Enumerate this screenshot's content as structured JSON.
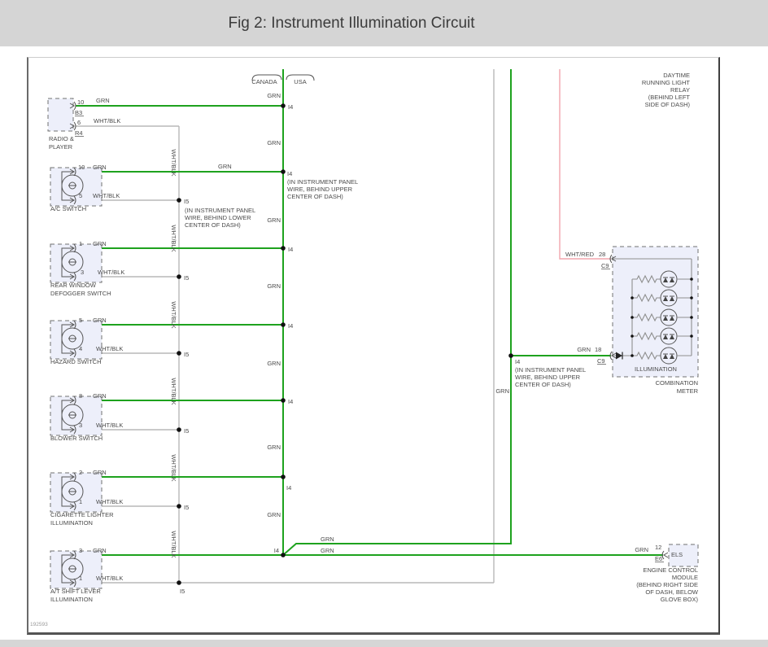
{
  "title": "Fig 2: Instrument Illumination Circuit",
  "doc_number": "192593",
  "top_labels": {
    "canada": "CANADA",
    "usa": "USA"
  },
  "wire_labels": {
    "grn": "GRN",
    "wht_blk": "WHT/BLK",
    "wht_red": "WHT/RED"
  },
  "nodes": {
    "i4": "I4",
    "i5": "I5"
  },
  "components": [
    {
      "name": [
        "RADIO &",
        "PLAYER"
      ],
      "pin_top": "10",
      "conn_top": "B3",
      "pin_bot": "6",
      "conn_bot": "R4"
    },
    {
      "name": [
        "A/C SWITCH"
      ],
      "pin_top": "10",
      "pin_bot": "5"
    },
    {
      "name": [
        "REAR WINDOW",
        "DEFOGGER SWITCH"
      ],
      "pin_top": "1",
      "pin_bot": "3"
    },
    {
      "name": [
        "HAZARD SWITCH"
      ],
      "pin_top": "5",
      "pin_bot": "4"
    },
    {
      "name": [
        "BLOWER SWITCH"
      ],
      "pin_top": "8",
      "pin_bot": "3"
    },
    {
      "name": [
        "CIGARETTE LIGHTER",
        "ILLUMINATION"
      ],
      "pin_top": "2",
      "pin_bot": "1"
    },
    {
      "name": [
        "A/T SHIFT LEVER",
        "ILLUMINATION"
      ],
      "pin_top": "3",
      "pin_bot": "1"
    }
  ],
  "annotations": {
    "panel_upper": [
      "(IN INSTRUMENT PANEL",
      "WIRE, BEHIND UPPER",
      "CENTER OF DASH)"
    ],
    "panel_lower": [
      "(IN INSTRUMENT PANEL",
      "WIRE, BEHIND LOWER",
      "CENTER OF DASH)"
    ],
    "drl": [
      "DAYTIME",
      "RUNNING LIGHT",
      "RELAY",
      "(BEHIND LEFT",
      "SIDE OF DASH)"
    ],
    "ecm_location": [
      "ENGINE CONTROL",
      "MODULE",
      "(BEHIND RIGHT SIDE",
      "OF DASH, BELOW",
      "GLOVE BOX)"
    ]
  },
  "combination_meter": {
    "input_top_pin": "28",
    "input_top_conn": "C9",
    "input_bot_pin": "18",
    "input_bot_conn": "C9",
    "internal_label": "ILLUMINATION",
    "name": [
      "COMBINATION",
      "METER"
    ]
  },
  "ecm": {
    "pin": "12",
    "conn": "E6",
    "terminal": "ELS"
  },
  "colors": {
    "grn_wire": "#1ea21e",
    "wht_blk_wire": "#b8b8b8",
    "wht_red_wire": "#f2a6ae"
  }
}
